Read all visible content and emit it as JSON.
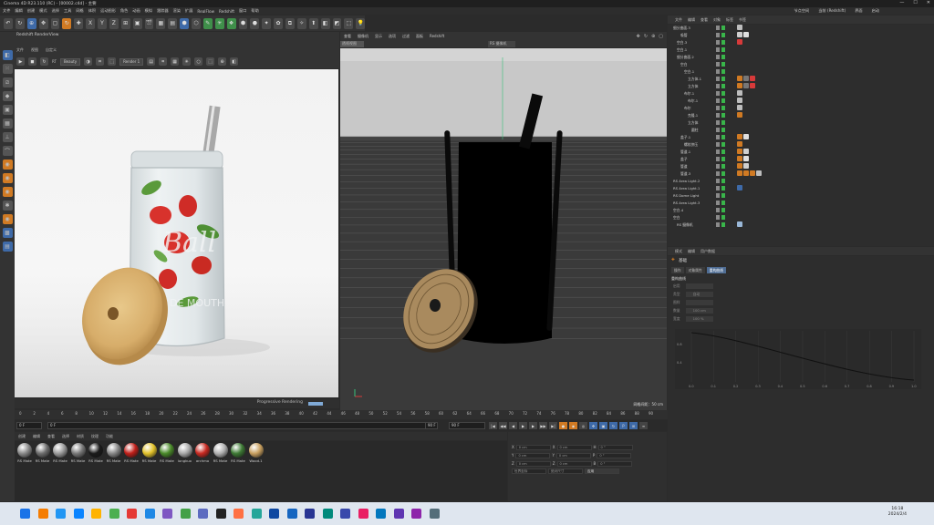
{
  "app": {
    "title": "Cinema 4D R23.110 (RC) - [00002.c4d] - 主要"
  },
  "menu": {
    "items": [
      "文件",
      "编辑",
      "创建",
      "模式",
      "选择",
      "工具",
      "网格",
      "体积",
      "运动图形",
      "角色",
      "动画",
      "模拟",
      "跟踪器",
      "渲染",
      "扩展",
      "RealFlow",
      "Redshift",
      "窗口",
      "帮助"
    ],
    "right": [
      "节点空间",
      "当前 (Redshift)",
      "界面",
      "启动"
    ]
  },
  "toolbar": {
    "buttons": [
      "↶",
      "↻",
      "⊕",
      "✥",
      "▢",
      "↻",
      "✚",
      "X",
      "Y",
      "Z",
      "⊞",
      "▣",
      "🎬",
      "▦",
      "▤",
      "⬢",
      "⬡",
      "✎",
      "✳",
      "❖",
      "⬢",
      "⬣",
      "✦",
      "✿",
      "⧉",
      "✧",
      "⬆",
      "◧",
      "◩",
      "⬚",
      "💡"
    ]
  },
  "render_view": {
    "title": "Redshift RenderView",
    "menu": [
      "文件",
      "视图",
      "自定义"
    ],
    "mode_dropdown": "Beauty",
    "snapshot_dropdown": "Render 1",
    "status_text": "Progressive Rendering",
    "label_on_jar": "DE MOUTH"
  },
  "viewport": {
    "menu": [
      "查看",
      "摄像机",
      "显示",
      "选项",
      "过滤",
      "面板",
      "Redshift"
    ],
    "tab": "透视视图",
    "camera": "RS 摄像机",
    "grid_info": "网格间距：50 cm"
  },
  "timeline": {
    "ticks": [
      "0",
      "2",
      "4",
      "6",
      "8",
      "10",
      "12",
      "14",
      "16",
      "18",
      "20",
      "22",
      "24",
      "26",
      "28",
      "30",
      "32",
      "34",
      "36",
      "38",
      "40",
      "42",
      "44",
      "46",
      "48",
      "50",
      "52",
      "54",
      "56",
      "58",
      "60",
      "62",
      "64",
      "66",
      "68",
      "70",
      "72",
      "74",
      "76",
      "78",
      "80",
      "82",
      "84",
      "86",
      "88",
      "90"
    ],
    "frame_end": "90 F",
    "current_frame": "0 F",
    "start_field": "0 F",
    "min_field": "0 F",
    "end_field": "90 F",
    "max_field": "90 F",
    "playhead_fraction": 0.0
  },
  "materials": {
    "menu": [
      "创建",
      "编辑",
      "查看",
      "选择",
      "材质",
      "纹理",
      "功能"
    ],
    "items": [
      {
        "name": "RS Mate",
        "color": "#8a8a8a"
      },
      {
        "name": "RS Mate",
        "color": "#6e6e6e"
      },
      {
        "name": "RS Mate",
        "color": "#9a9a9a"
      },
      {
        "name": "RS Mate",
        "color": "#787878"
      },
      {
        "name": "RS Mate",
        "color": "#1a1a1a"
      },
      {
        "name": "RS Mate",
        "color": "#888888"
      },
      {
        "name": "RS Mate",
        "color": "#c0201a"
      },
      {
        "name": "RS Mate",
        "color": "#e2c22a"
      },
      {
        "name": "RS Mate",
        "color": "#4a8a2a"
      },
      {
        "name": "longkuo",
        "color": "#a8a8a8"
      },
      {
        "name": "archmo",
        "color": "#c92a22"
      },
      {
        "name": "RS Mate",
        "color": "#b0b0b0"
      },
      {
        "name": "RS Mate",
        "color": "#3e7a35"
      },
      {
        "name": "Wood.1",
        "color": "#c8a060"
      }
    ]
  },
  "coords": {
    "rows": [
      {
        "a": "X",
        "av": "0 cm",
        "b": "X",
        "bv": "0 cm",
        "c": "H",
        "cv": "0 °"
      },
      {
        "a": "Y",
        "av": "0 cm",
        "b": "Y",
        "bv": "0 cm",
        "c": "P",
        "cv": "0 °"
      },
      {
        "a": "Z",
        "av": "0 cm",
        "b": "Z",
        "bv": "0 cm",
        "c": "B",
        "cv": "0 °"
      }
    ],
    "mode1": "世界坐标",
    "mode2": "绝对尺寸",
    "apply": "应用"
  },
  "object_manager": {
    "menu": [
      "文件",
      "编辑",
      "查看",
      "对象",
      "标签",
      "书签"
    ],
    "rows": [
      {
        "indent": 0,
        "name": "细分曲面.3",
        "tags": [
          "#bdbdbd"
        ]
      },
      {
        "indent": 2,
        "name": "吸管",
        "tags": [
          "#cfcfcf",
          "#e0e0e0"
        ]
      },
      {
        "indent": 1,
        "name": "空白.3",
        "tags": [
          "#d73a3a"
        ]
      },
      {
        "indent": 1,
        "name": "空白.1",
        "tags": []
      },
      {
        "indent": 1,
        "name": "细分曲面.2",
        "tags": []
      },
      {
        "indent": 2,
        "name": "空白",
        "tags": []
      },
      {
        "indent": 3,
        "name": "空白.1",
        "tags": []
      },
      {
        "indent": 4,
        "name": "立方体.1",
        "tags": [
          "#d07a23",
          "#777",
          "#d73a3a"
        ]
      },
      {
        "indent": 4,
        "name": "立方体",
        "tags": [
          "#d07a23",
          "#777",
          "#d73a3a"
        ]
      },
      {
        "indent": 3,
        "name": "布尔.1",
        "tags": [
          "#bdbdbd"
        ]
      },
      {
        "indent": 4,
        "name": "布尔.1",
        "tags": [
          "#bdbdbd"
        ]
      },
      {
        "indent": 3,
        "name": "布尔",
        "tags": [
          "#bdbdbd"
        ]
      },
      {
        "indent": 4,
        "name": "克隆.1",
        "tags": [
          "#d07a23"
        ]
      },
      {
        "indent": 4,
        "name": "立方体",
        "tags": []
      },
      {
        "indent": 5,
        "name": "圆柱",
        "tags": []
      },
      {
        "indent": 2,
        "name": "盖子.1",
        "tags": [
          "#d07a23",
          "#e0e0e0"
        ]
      },
      {
        "indent": 3,
        "name": "螺纹挤压",
        "tags": [
          "#d07a23"
        ]
      },
      {
        "indent": 2,
        "name": "管道.1",
        "tags": [
          "#d07a23",
          "#cfcfcf"
        ]
      },
      {
        "indent": 2,
        "name": "盖子",
        "tags": [
          "#d07a23",
          "#e0e0e0"
        ]
      },
      {
        "indent": 2,
        "name": "管道",
        "tags": [
          "#d07a23",
          "#cfcfcf"
        ]
      },
      {
        "indent": 2,
        "name": "管道.3",
        "tags": [
          "#d07a23",
          "#d07a23",
          "#d07a23",
          "#bdbdbd"
        ]
      },
      {
        "indent": 0,
        "name": "RS Area Light.2",
        "tags": []
      },
      {
        "indent": 0,
        "name": "RS Area Light.1",
        "tags": [
          "#3e6aa8"
        ]
      },
      {
        "indent": 0,
        "name": "RS Dome Light",
        "tags": []
      },
      {
        "indent": 0,
        "name": "RS Area Light.3",
        "tags": []
      },
      {
        "indent": 0,
        "name": "空白.4",
        "tags": []
      },
      {
        "indent": 0,
        "name": "空白",
        "tags": []
      },
      {
        "indent": 1,
        "name": "RS 摄像机",
        "tags": [
          "#9ab8d8"
        ]
      }
    ]
  },
  "attributes": {
    "menu": [
      "模式",
      "编辑",
      "用户数据"
    ],
    "title": "基础",
    "tabs": [
      "操作",
      "对象属性",
      "重构曲线"
    ],
    "section": "重构曲线",
    "fields": [
      {
        "label": "启用",
        "value": ""
      },
      {
        "label": "类型",
        "value": "自动"
      },
      {
        "label": "图样",
        "value": ""
      },
      {
        "label": "数量",
        "value": "100 cm"
      },
      {
        "label": "宽度",
        "value": "100 %"
      }
    ],
    "graph_x_labels": [
      "0.0",
      "0.1",
      "0.2",
      "0.3",
      "0.4",
      "0.5",
      "0.6",
      "0.7",
      "0.8",
      "0.9",
      "1.0"
    ],
    "graph_y_labels": [
      "0.8",
      "0.4"
    ]
  },
  "taskbar": {
    "time": "16:18",
    "date": "2024/2/4"
  }
}
